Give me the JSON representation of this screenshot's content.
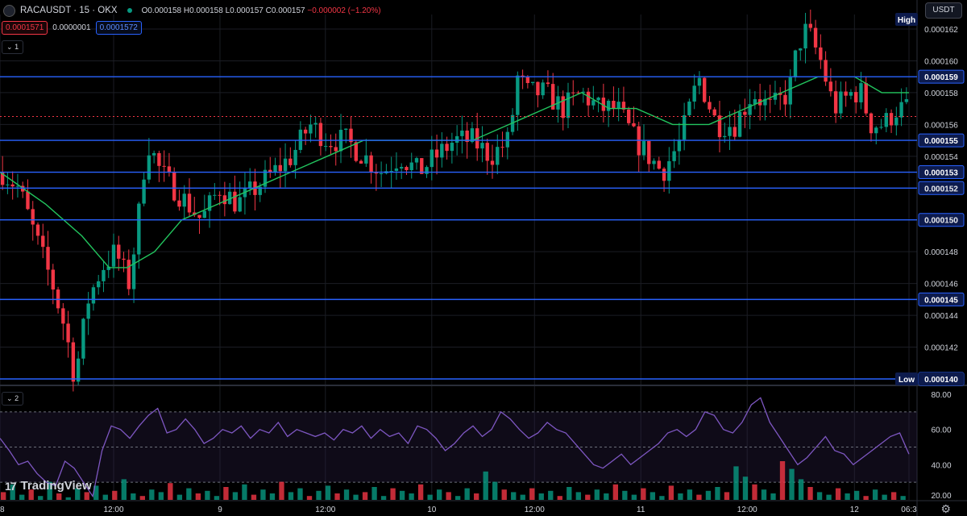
{
  "header": {
    "symbol": "RACAUSDT · 15 · OKX",
    "open": "O0.000158",
    "high": "H0.000158",
    "low": "L0.000157",
    "close": "C0.000157",
    "change": "−0.000002 (−1.20%)"
  },
  "trade": {
    "sell": "0.0001571",
    "spread": "0.0000001",
    "buy": "0.0001572"
  },
  "panes": {
    "main_label": "1",
    "rsi_label": "2"
  },
  "currency": "USDT",
  "brand": "TradingView",
  "brand_mark": "17",
  "colors": {
    "up": "#089981",
    "down": "#f23645",
    "ma": "#22c55e",
    "rsi": "#7e57c2",
    "hline": "#2962ff",
    "grid": "#1b1d24",
    "text": "#d1d4dc",
    "current": "#f23645"
  },
  "chart_data": [
    {
      "type": "candlestick",
      "symbol": "RACAUSDT",
      "interval": "15",
      "exchange": "OKX",
      "ylim": [
        0.00014,
        0.000162
      ],
      "yticks": [
        "0.000162",
        "0.000160",
        "0.000158",
        "0.000156",
        "0.000154",
        "0.000152",
        "0.000150",
        "0.000148",
        "0.000146",
        "0.000144",
        "0.000142",
        "0.000140"
      ],
      "x_ticks": [
        {
          "label": "8",
          "t": 0
        },
        {
          "label": "12:00",
          "t": 0.125
        },
        {
          "label": "9",
          "t": 0.242
        },
        {
          "label": "12:00",
          "t": 0.358
        },
        {
          "label": "10",
          "t": 0.475
        },
        {
          "label": "12:00",
          "t": 0.588
        },
        {
          "label": "11",
          "t": 0.705
        },
        {
          "label": "12:00",
          "t": 0.822
        },
        {
          "label": "12",
          "t": 0.94
        },
        {
          "label": "06:3",
          "t": 1.0
        }
      ],
      "series_outline": [
        [
          0.0,
          0.000153
        ],
        [
          0.018,
          0.000152
        ],
        [
          0.036,
          0.000149
        ],
        [
          0.055,
          0.000146
        ],
        [
          0.07,
          0.000143
        ],
        [
          0.08,
          0.00014
        ],
        [
          0.095,
          0.000145
        ],
        [
          0.11,
          0.000147
        ],
        [
          0.125,
          0.000148
        ],
        [
          0.14,
          0.000146
        ],
        [
          0.15,
          0.00015
        ],
        [
          0.16,
          0.000155
        ],
        [
          0.175,
          0.000153
        ],
        [
          0.19,
          0.000152
        ],
        [
          0.205,
          0.000151
        ],
        [
          0.22,
          0.00015
        ],
        [
          0.24,
          0.000152
        ],
        [
          0.26,
          0.000151
        ],
        [
          0.28,
          0.000152
        ],
        [
          0.3,
          0.000153
        ],
        [
          0.32,
          0.000154
        ],
        [
          0.34,
          0.000156
        ],
        [
          0.36,
          0.000155
        ],
        [
          0.38,
          0.000155
        ],
        [
          0.4,
          0.000154
        ],
        [
          0.42,
          0.000153
        ],
        [
          0.44,
          0.000154
        ],
        [
          0.46,
          0.000153
        ],
        [
          0.48,
          0.000154
        ],
        [
          0.5,
          0.000155
        ],
        [
          0.52,
          0.000155
        ],
        [
          0.54,
          0.000154
        ],
        [
          0.56,
          0.000155
        ],
        [
          0.57,
          0.000159
        ],
        [
          0.58,
          0.000158
        ],
        [
          0.6,
          0.000158
        ],
        [
          0.62,
          0.000157
        ],
        [
          0.64,
          0.000158
        ],
        [
          0.66,
          0.000157
        ],
        [
          0.68,
          0.000157
        ],
        [
          0.7,
          0.000155
        ],
        [
          0.715,
          0.000154
        ],
        [
          0.73,
          0.000153
        ],
        [
          0.75,
          0.000155
        ],
        [
          0.77,
          0.000159
        ],
        [
          0.79,
          0.000156
        ],
        [
          0.81,
          0.000156
        ],
        [
          0.83,
          0.000158
        ],
        [
          0.85,
          0.000157
        ],
        [
          0.87,
          0.000158
        ],
        [
          0.88,
          0.000161
        ],
        [
          0.89,
          0.000162
        ],
        [
          0.905,
          0.00016
        ],
        [
          0.92,
          0.000157
        ],
        [
          0.94,
          0.000158
        ],
        [
          0.95,
          0.000158
        ],
        [
          0.96,
          0.000156
        ],
        [
          0.975,
          0.000156
        ],
        [
          0.99,
          0.000157
        ],
        [
          1.0,
          0.000157
        ]
      ],
      "moving_average_outline": [
        [
          0.0,
          0.000153
        ],
        [
          0.05,
          0.000151
        ],
        [
          0.09,
          0.000149
        ],
        [
          0.12,
          0.000147
        ],
        [
          0.14,
          0.000147
        ],
        [
          0.17,
          0.000148
        ],
        [
          0.2,
          0.00015
        ],
        [
          0.24,
          0.000151
        ],
        [
          0.28,
          0.000152
        ],
        [
          0.32,
          0.000153
        ],
        [
          0.36,
          0.000154
        ],
        [
          0.4,
          0.000155
        ],
        [
          0.44,
          0.000155
        ],
        [
          0.48,
          0.000155
        ],
        [
          0.52,
          0.000155
        ],
        [
          0.56,
          0.000156
        ],
        [
          0.6,
          0.000157
        ],
        [
          0.64,
          0.000158
        ],
        [
          0.67,
          0.000157
        ],
        [
          0.7,
          0.000157
        ],
        [
          0.74,
          0.000156
        ],
        [
          0.78,
          0.000156
        ],
        [
          0.82,
          0.000157
        ],
        [
          0.86,
          0.000158
        ],
        [
          0.9,
          0.000159
        ],
        [
          0.94,
          0.000159
        ],
        [
          0.97,
          0.000158
        ],
        [
          1.0,
          0.000158
        ]
      ],
      "horizontal_levels": [
        "0.000159",
        "0.000155",
        "0.000153",
        "0.000152",
        "0.000150",
        "0.000145",
        "0.000140"
      ],
      "current_price": 0.0001565,
      "high_label": "High",
      "low_label": "Low",
      "low_value": "0.000140"
    },
    {
      "type": "line",
      "title": "",
      "ylim": [
        20,
        80
      ],
      "yticks": [
        "80.00",
        "60.00",
        "40.00",
        "20.00"
      ],
      "reference_levels": [
        70,
        50,
        30
      ],
      "series": [
        {
          "values": [
            55,
            48,
            40,
            42,
            35,
            30,
            28,
            42,
            38,
            30,
            22,
            48,
            62,
            60,
            55,
            62,
            68,
            72,
            58,
            60,
            66,
            60,
            52,
            55,
            60,
            58,
            62,
            55,
            60,
            58,
            64,
            56,
            60,
            58,
            56,
            58,
            54,
            60,
            58,
            62,
            55,
            60,
            56,
            58,
            52,
            62,
            60,
            55,
            48,
            52,
            58,
            62,
            56,
            60,
            70,
            66,
            60,
            55,
            58,
            64,
            60,
            58,
            52,
            46,
            40,
            38,
            42,
            46,
            40,
            44,
            48,
            52,
            58,
            60,
            56,
            60,
            70,
            68,
            60,
            58,
            64,
            74,
            78,
            64,
            56,
            48,
            40,
            44,
            50,
            56,
            48,
            46,
            40,
            44,
            48,
            52,
            56,
            58,
            46
          ]
        }
      ],
      "volume_bars": [
        6,
        12,
        4,
        8,
        3,
        14,
        5,
        2,
        9,
        6,
        11,
        4,
        7,
        16,
        5,
        3,
        8,
        6,
        13,
        4,
        9,
        5,
        7,
        3,
        10,
        6,
        12,
        4,
        8,
        5,
        14,
        6,
        9,
        3,
        7,
        11,
        5,
        8,
        4,
        6,
        10,
        3,
        9,
        7,
        5,
        12,
        4,
        8,
        6,
        3,
        9,
        5,
        22,
        14,
        8,
        6,
        4,
        9,
        5,
        7,
        3,
        10,
        6,
        4,
        8,
        5,
        12,
        7,
        4,
        9,
        6,
        3,
        11,
        5,
        8,
        4,
        7,
        10,
        6,
        26,
        18,
        12,
        8,
        5,
        30,
        24,
        16,
        10,
        6,
        4,
        9,
        5,
        7,
        3,
        8,
        4,
        6,
        3
      ]
    }
  ]
}
